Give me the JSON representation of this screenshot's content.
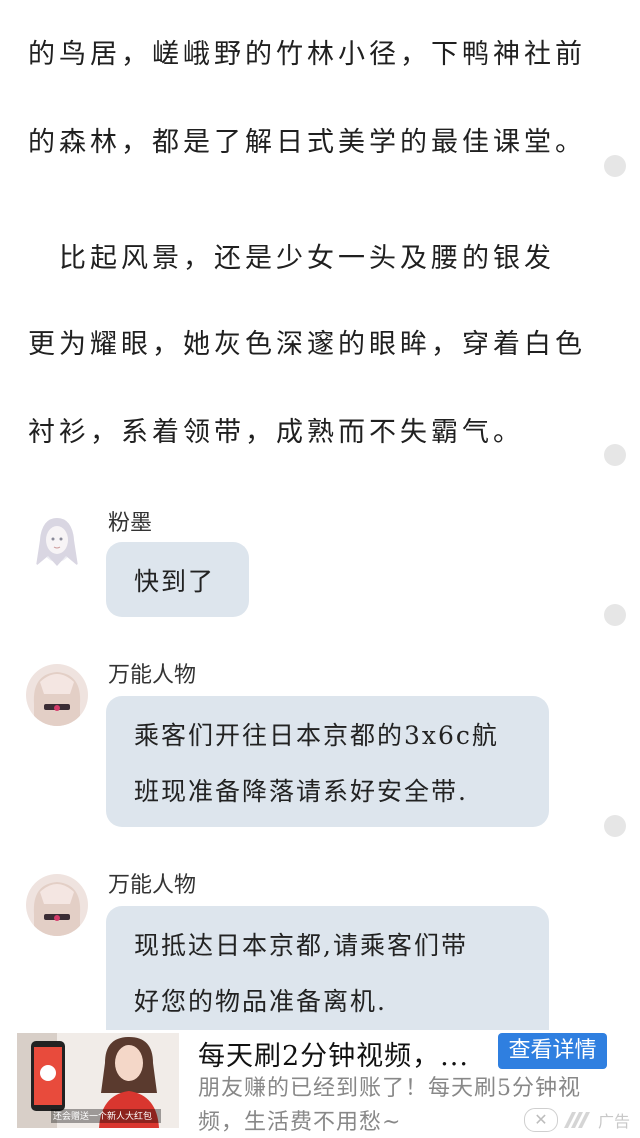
{
  "article": {
    "lines": [
      "的鸟居，嵯峨野的竹林小径，下鸭神社前",
      "的森林，都是了解日式美学的最佳课堂。",
      "　比起风景，还是少女一头及腰的银发",
      "更为耀眼，她灰色深邃的眼眸，穿着白色",
      "衬衫，系着领带，成熟而不失霸气。"
    ]
  },
  "chat": {
    "messages": [
      {
        "sender": "粉墨",
        "lines": [
          "快到了"
        ]
      },
      {
        "sender": "万能人物",
        "lines": [
          "乘客们开往日本京都的3x6c航",
          "班现准备降落请系好安全带."
        ]
      },
      {
        "sender": "万能人物",
        "lines": [
          "现抵达日本京都,请乘客们带",
          "好您的物品准备离机."
        ]
      }
    ]
  },
  "ad": {
    "title": "每天刷2分钟视频，...",
    "button_label": "查看详情",
    "description_lines": [
      "朋友赚的已经到账了！每天刷5分钟视",
      "频，生活费不用愁~"
    ],
    "thumb_caption": "还会赠送一个新人大红包",
    "close_symbol": "✕",
    "ad_label": "广告"
  },
  "colors": {
    "bubble": "#dde5ed",
    "ad_button": "#2f7fe0"
  }
}
